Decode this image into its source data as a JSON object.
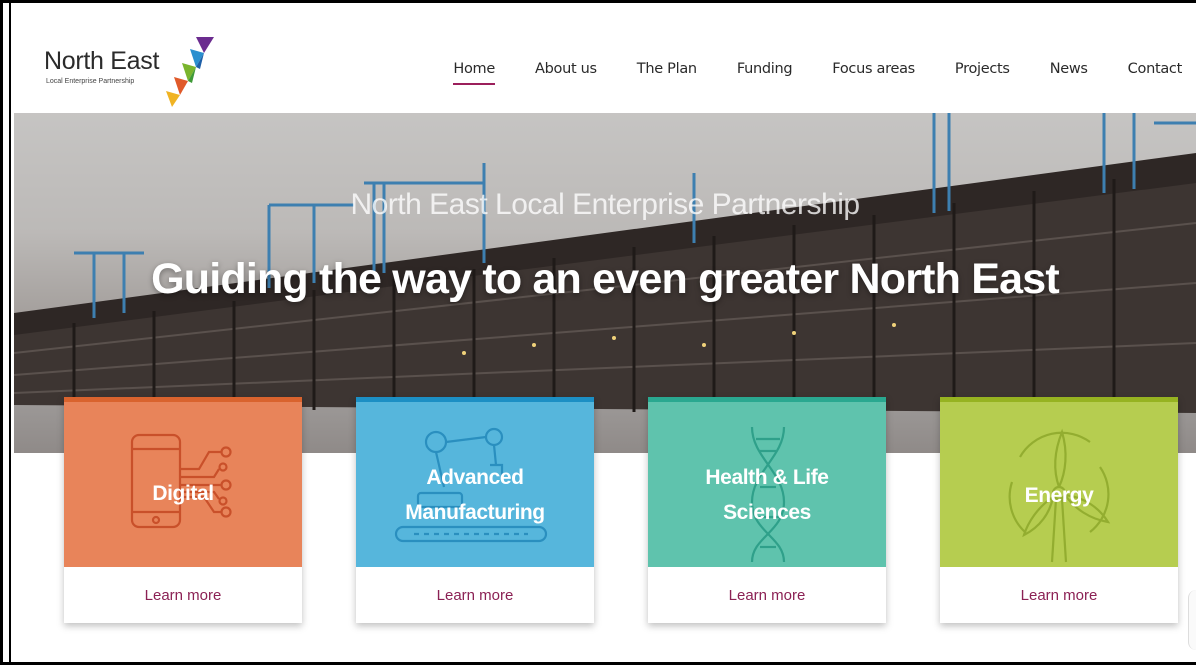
{
  "logo": {
    "name": "North East",
    "tagline": "Local Enterprise Partnership",
    "colors": [
      "#6b2c8f",
      "#2a8fcf",
      "#7ab52d",
      "#e05a2a",
      "#f0b323"
    ]
  },
  "nav": {
    "items": [
      {
        "label": "Home",
        "active": true
      },
      {
        "label": "About us"
      },
      {
        "label": "The Plan"
      },
      {
        "label": "Funding"
      },
      {
        "label": "Focus areas"
      },
      {
        "label": "Projects"
      },
      {
        "label": "News"
      },
      {
        "label": "Contact"
      }
    ],
    "active_color": "#9b1f5b"
  },
  "hero": {
    "subtitle": "North East Local Enterprise Partnership",
    "title": "Guiding the way to an even greater North East"
  },
  "cards": [
    {
      "title": "Digital",
      "link": "Learn more",
      "icon": "smartphone-circuit-icon",
      "color": "#e8845a",
      "bar": "#d9632e"
    },
    {
      "title_line1": "Advanced",
      "title_line2": "Manufacturing",
      "link": "Learn more",
      "icon": "robot-arm-conveyor-icon",
      "color": "#56b6dc",
      "bar": "#1c8fc4"
    },
    {
      "title_line1": "Health & Life",
      "title_line2": "Sciences",
      "link": "Learn more",
      "icon": "dna-helix-icon",
      "color": "#5fc3ad",
      "bar": "#2aa890"
    },
    {
      "title": "Energy",
      "link": "Learn more",
      "icon": "wind-turbine-icon",
      "color": "#b6cd50",
      "bar": "#96b321"
    }
  ]
}
